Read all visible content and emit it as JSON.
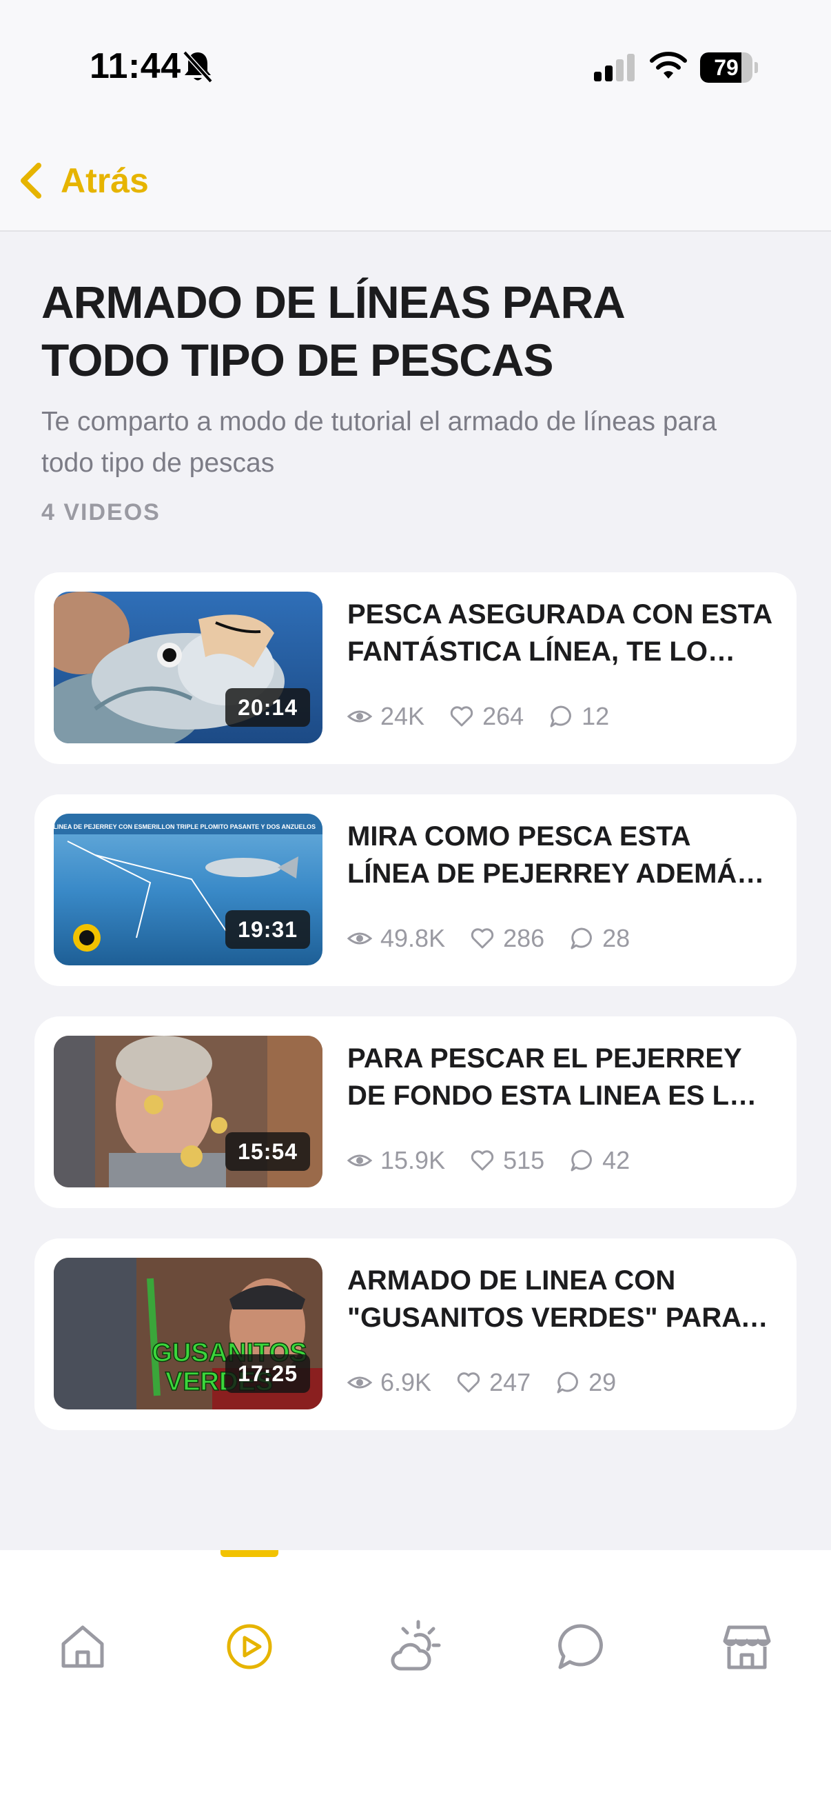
{
  "status_bar": {
    "time": "11:44",
    "battery": "79",
    "battery_level": 0.79
  },
  "nav": {
    "back_label": "Atrás"
  },
  "playlist": {
    "title": "ARMADO DE LÍNEAS PARA TODO TIPO DE PESCAS",
    "description": "Te comparto a modo de tutorial el armado de líneas para todo tipo de pescas",
    "count": "4 VIDEOS"
  },
  "videos": [
    {
      "title": "PESCA ASEGURADA CON ESTA FANTÁSTICA LÍNEA, TE LO ASEGURO",
      "duration": "20:14",
      "views": "24K",
      "likes": "264",
      "comments": "12"
    },
    {
      "title": "MIRA COMO PESCA ESTA LÍNEA DE PEJERREY ADEMÁS DE",
      "duration": "19:31",
      "views": "49.8K",
      "likes": "286",
      "comments": "28"
    },
    {
      "title": "PARA PESCAR EL PEJERREY DE FONDO ESTA LINEA ES LA MEJOR",
      "duration": "15:54",
      "views": "15.9K",
      "likes": "515",
      "comments": "42"
    },
    {
      "title": "ARMADO DE LINEA CON \"GUSANITOS VERDES\" PARA PESCAR",
      "duration": "17:25",
      "views": "6.9K",
      "likes": "247",
      "comments": "29"
    }
  ],
  "thumbnail_texts": {
    "v2_caption": "LINEA DE PEJERREY CON ESMERILLON TRIPLE PLOMITO PASANTE Y DOS ANZUELOS",
    "v4_overlay_1": "GUSANITOS",
    "v4_overlay_2": "VERDES"
  },
  "tab_bar": {
    "tabs": [
      "home-icon",
      "play-icon",
      "weather-icon",
      "chat-icon",
      "store-icon"
    ],
    "active": 1
  },
  "colors": {
    "accent": "#e6b400",
    "tab_indicator": "#f2c200",
    "background": "#f2f2f6",
    "muted": "#9a9aa2"
  }
}
